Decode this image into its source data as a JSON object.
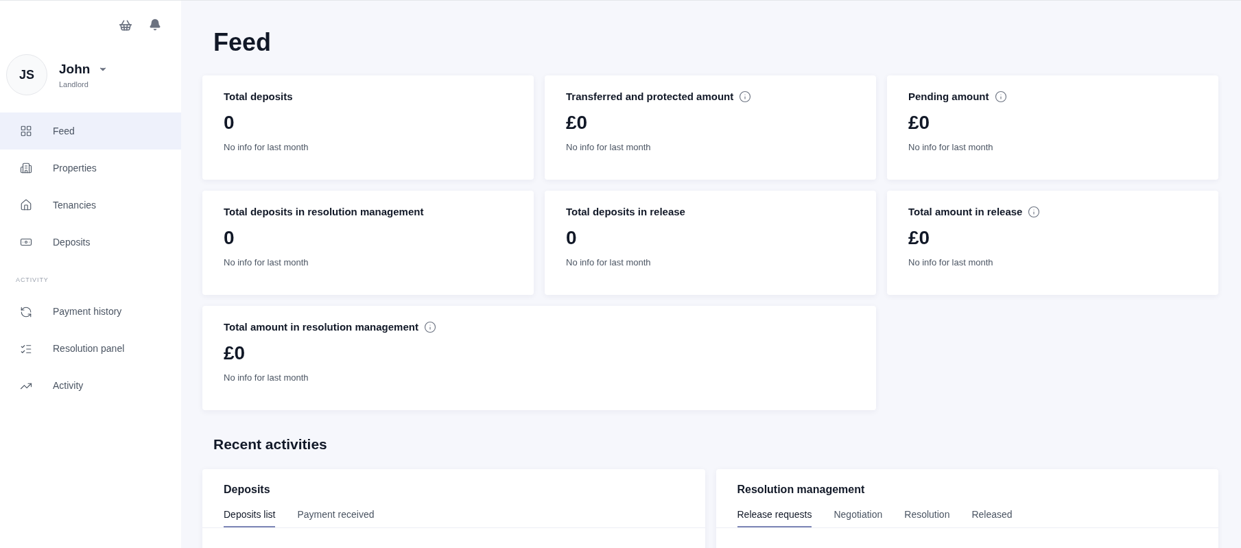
{
  "user": {
    "initials": "JS",
    "name": "John",
    "role": "Landlord"
  },
  "nav": [
    {
      "label": "Feed",
      "selected": true
    },
    {
      "label": "Properties",
      "selected": false
    },
    {
      "label": "Tenancies",
      "selected": false
    },
    {
      "label": "Deposits",
      "selected": false
    }
  ],
  "nav_section": "ACTIVITY",
  "activity_nav": [
    {
      "label": "Payment history",
      "selected": false
    },
    {
      "label": "Resolution panel",
      "selected": false
    },
    {
      "label": "Activity",
      "selected": false
    }
  ],
  "page_title": "Feed",
  "stats": [
    {
      "title": "Total deposits",
      "info": false,
      "value": "0",
      "note": "No info for last month"
    },
    {
      "title": "Transferred and protected amount",
      "info": true,
      "value": "£0",
      "note": "No info for last month"
    },
    {
      "title": "Pending amount",
      "info": true,
      "value": "£0",
      "note": "No info for last month"
    },
    {
      "title": "Total deposits in resolution management",
      "info": false,
      "value": "0",
      "note": "No info for last month"
    },
    {
      "title": "Total deposits in release",
      "info": false,
      "value": "0",
      "note": "No info for last month"
    },
    {
      "title": "Total amount in release",
      "info": true,
      "value": "£0",
      "note": "No info for last month"
    },
    {
      "title": "Total amount in resolution management",
      "info": true,
      "value": "£0",
      "note": "No info for last month"
    }
  ],
  "recent_title": "Recent activities",
  "panels": [
    {
      "title": "Deposits",
      "tabs": [
        {
          "label": "Deposits list",
          "selected": true
        },
        {
          "label": "Payment received",
          "selected": false
        }
      ]
    },
    {
      "title": "Resolution management",
      "tabs": [
        {
          "label": "Release requests",
          "selected": true
        },
        {
          "label": "Negotiation",
          "selected": false
        },
        {
          "label": "Resolution",
          "selected": false
        },
        {
          "label": "Released",
          "selected": false
        }
      ]
    }
  ]
}
